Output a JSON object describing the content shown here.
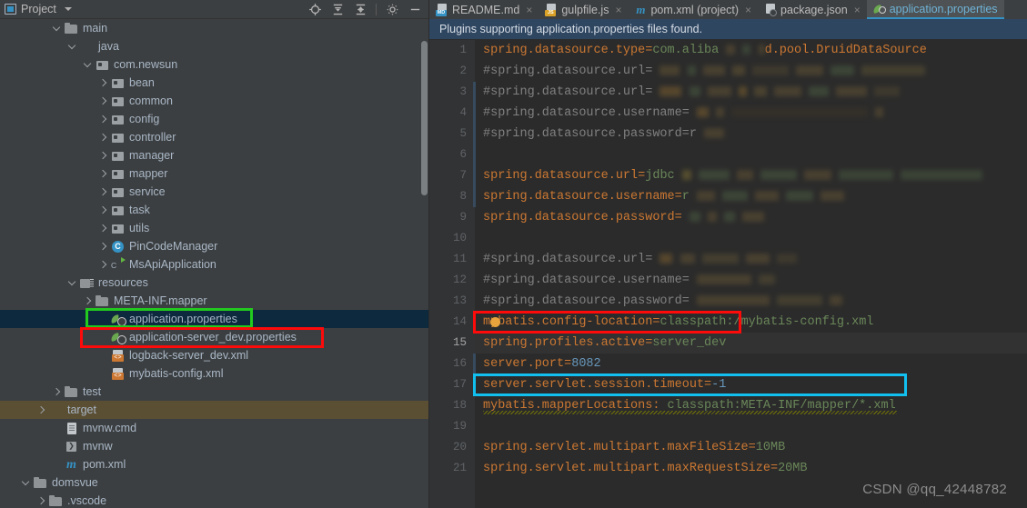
{
  "panel": {
    "title": "Project",
    "icons": [
      {
        "name": "locate-icon"
      },
      {
        "name": "expand-all-icon"
      },
      {
        "name": "collapse-all-icon"
      },
      {
        "name": "gear-icon"
      },
      {
        "name": "minimize-icon"
      }
    ]
  },
  "tree": [
    {
      "label": "main",
      "indent": 3,
      "chev": "down",
      "icon": "folder",
      "state": "normal"
    },
    {
      "label": "java",
      "indent": 4,
      "chev": "down",
      "icon": "folder-blue",
      "state": "normal"
    },
    {
      "label": "com.newsun",
      "indent": 5,
      "chev": "down",
      "icon": "pkg",
      "state": "normal"
    },
    {
      "label": "bean",
      "indent": 6,
      "chev": "right",
      "icon": "pkg",
      "state": "normal"
    },
    {
      "label": "common",
      "indent": 6,
      "chev": "right",
      "icon": "pkg",
      "state": "normal"
    },
    {
      "label": "config",
      "indent": 6,
      "chev": "right",
      "icon": "pkg",
      "state": "normal"
    },
    {
      "label": "controller",
      "indent": 6,
      "chev": "right",
      "icon": "pkg",
      "state": "normal"
    },
    {
      "label": "manager",
      "indent": 6,
      "chev": "right",
      "icon": "pkg",
      "state": "normal"
    },
    {
      "label": "mapper",
      "indent": 6,
      "chev": "right",
      "icon": "pkg",
      "state": "normal"
    },
    {
      "label": "service",
      "indent": 6,
      "chev": "right",
      "icon": "pkg",
      "state": "normal"
    },
    {
      "label": "task",
      "indent": 6,
      "chev": "right",
      "icon": "pkg",
      "state": "normal"
    },
    {
      "label": "utils",
      "indent": 6,
      "chev": "right",
      "icon": "pkg",
      "state": "normal"
    },
    {
      "label": "PinCodeManager",
      "indent": 6,
      "chev": "right",
      "icon": "cls",
      "state": "normal"
    },
    {
      "label": "MsApiApplication",
      "indent": 6,
      "chev": "right",
      "icon": "cls-run",
      "state": "normal"
    },
    {
      "label": "resources",
      "indent": 4,
      "chev": "down",
      "icon": "res",
      "state": "normal"
    },
    {
      "label": "META-INF.mapper",
      "indent": 5,
      "chev": "right",
      "icon": "folder",
      "state": "normal"
    },
    {
      "label": "application.properties",
      "indent": 6,
      "chev": "none",
      "icon": "prop",
      "state": "selected"
    },
    {
      "label": "application-server_dev.properties",
      "indent": 6,
      "chev": "none",
      "icon": "prop",
      "state": "normal"
    },
    {
      "label": "logback-server_dev.xml",
      "indent": 6,
      "chev": "none",
      "icon": "xml",
      "state": "normal"
    },
    {
      "label": "mybatis-config.xml",
      "indent": 6,
      "chev": "none",
      "icon": "xml",
      "state": "normal"
    },
    {
      "label": "test",
      "indent": 3,
      "chev": "right",
      "icon": "folder",
      "state": "normal"
    },
    {
      "label": "target",
      "indent": 2,
      "chev": "right",
      "icon": "folder-orange",
      "state": "highlight"
    },
    {
      "label": "mvnw.cmd",
      "indent": 3,
      "chev": "none",
      "icon": "cmd",
      "state": "normal"
    },
    {
      "label": "mvnw",
      "indent": 3,
      "chev": "none",
      "icon": "sh",
      "state": "normal"
    },
    {
      "label": "pom.xml",
      "indent": 3,
      "chev": "none",
      "icon": "mvn",
      "state": "normal"
    },
    {
      "label": "domsvue",
      "indent": 1,
      "chev": "down",
      "icon": "folder",
      "state": "normal"
    },
    {
      "label": ".vscode",
      "indent": 2,
      "chev": "right",
      "icon": "folder",
      "state": "normal"
    }
  ],
  "tabs": [
    {
      "label": "README.md",
      "icon": "markdown-file-icon",
      "active": false,
      "close": "×"
    },
    {
      "label": "gulpfile.js",
      "icon": "javascript-file-icon",
      "active": false,
      "close": "×"
    },
    {
      "label": "pom.xml (project)",
      "icon": "maven-file-icon",
      "active": false,
      "close": "×"
    },
    {
      "label": "package.json",
      "icon": "json-file-icon",
      "active": false,
      "close": "×"
    },
    {
      "label": "application.properties",
      "icon": "properties-file-icon",
      "active": true,
      "close": ""
    }
  ],
  "notification": "Plugins supporting application.properties files found.",
  "editor": {
    "lines": [
      {
        "num": "1",
        "key": "spring.datasource.type",
        "sep": "=",
        "val": "com.aliba",
        "tail_blurred": true,
        "tail_visible": "d.pool.DruidDataSource",
        "kind": "prop",
        "current": false
      },
      {
        "num": "2",
        "key": "#spring.datasource.url",
        "sep": "=",
        "val": "",
        "kind": "comment",
        "current": false
      },
      {
        "num": "3",
        "key": "#spring.datasource.url",
        "sep": "=",
        "val": "",
        "kind": "comment",
        "current": false
      },
      {
        "num": "4",
        "key": "#spring.datasource.username",
        "sep": "=",
        "val": "",
        "kind": "comment",
        "current": false
      },
      {
        "num": "5",
        "key": "#spring.datasource.password",
        "sep": "=",
        "val": "r",
        "kind": "comment",
        "current": false
      },
      {
        "num": "6",
        "key": "",
        "sep": "",
        "val": "",
        "kind": "blank",
        "current": false
      },
      {
        "num": "7",
        "key": "spring.datasource.url",
        "sep": "=",
        "val": "jdbc",
        "kind": "prop",
        "current": false
      },
      {
        "num": "8",
        "key": "spring.datasource.username",
        "sep": "=",
        "val": "r",
        "kind": "prop",
        "current": false
      },
      {
        "num": "9",
        "key": "spring.datasource.password",
        "sep": "=",
        "val": "",
        "kind": "prop",
        "current": false
      },
      {
        "num": "10",
        "key": "",
        "sep": "",
        "val": "",
        "kind": "blank",
        "current": false
      },
      {
        "num": "11",
        "key": "#spring.datasource.url",
        "sep": "=",
        "val": "",
        "kind": "comment",
        "current": false
      },
      {
        "num": "12",
        "key": "#spring.datasource.username",
        "sep": "=",
        "val": "",
        "kind": "comment",
        "current": false
      },
      {
        "num": "13",
        "key": "#spring.datasource.password",
        "sep": "=",
        "val": "",
        "kind": "comment",
        "current": false
      },
      {
        "num": "14",
        "key": "mybatis.config-location",
        "sep": "=",
        "val": "classpath:/mybatis-config.xml",
        "kind": "prop",
        "current": false
      },
      {
        "num": "15",
        "key": "spring.profiles.active",
        "sep": "=",
        "val": "server_dev",
        "kind": "prop",
        "current": true
      },
      {
        "num": "16",
        "key": "server.port",
        "sep": "=",
        "val": "8082",
        "kind": "number",
        "current": false
      },
      {
        "num": "17",
        "key": "server.servlet.session.timeout",
        "sep": "=",
        "val": "-1",
        "kind": "number",
        "current": false
      },
      {
        "num": "18",
        "key": "mybatis.mapperLocations:",
        "sep": " ",
        "val": "classpath:META-INF/mapper/*.xml",
        "kind": "prop-warn",
        "current": false
      },
      {
        "num": "19",
        "key": "",
        "sep": "",
        "val": "",
        "kind": "blank",
        "current": false
      },
      {
        "num": "20",
        "key": "spring.servlet.multipart.maxFileSize",
        "sep": "=",
        "val": "10MB",
        "kind": "prop",
        "current": false
      },
      {
        "num": "21",
        "key": "spring.servlet.multipart.maxRequestSize",
        "sep": "=",
        "val": "20MB",
        "kind": "prop",
        "current": false
      }
    ]
  },
  "annotations": [
    {
      "name": "green-highlight-application-properties",
      "color": "#22c91e"
    },
    {
      "name": "red-highlight-application-server-dev-properties",
      "color": "#fd0a0a"
    },
    {
      "name": "red-highlight-spring-profiles-active",
      "color": "#fd0a0a"
    },
    {
      "name": "cyan-highlight-mybatis-mapperlocations",
      "color": "#12c0f0"
    }
  ],
  "watermark": "CSDN @qq_42448782",
  "colors": {
    "accent": "#3592c4",
    "key": "#cc7832",
    "value": "#6a8759",
    "number": "#6897bb",
    "comment": "#808080",
    "selection": "#0d293e",
    "target_highlight": "#5a4e33"
  }
}
